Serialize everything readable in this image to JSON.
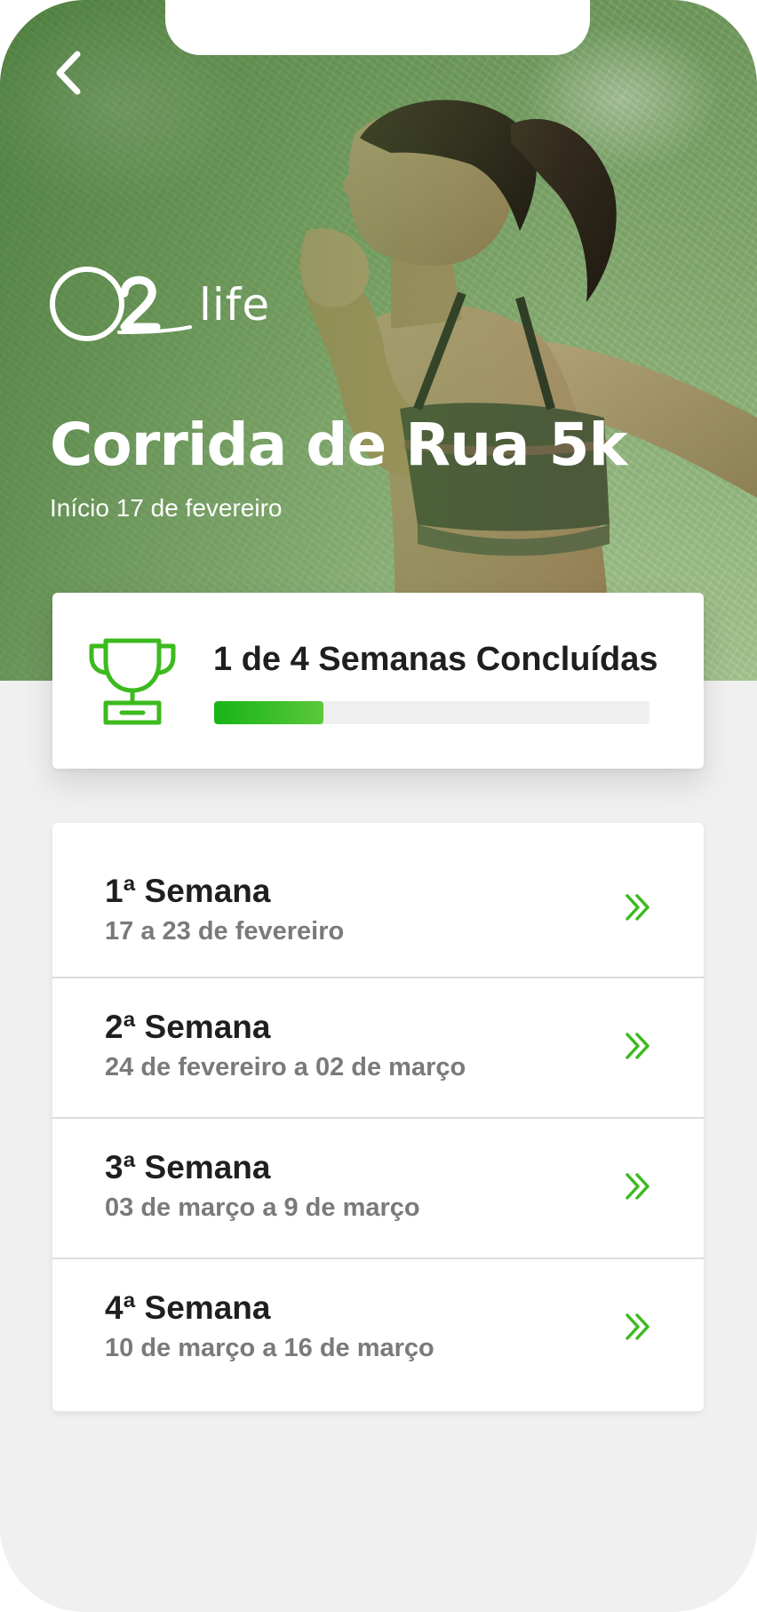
{
  "header": {
    "back_icon": "chevron-left-icon",
    "logo_text": "life",
    "title": "Corrida de Rua 5k",
    "subtitle": "Início 17 de fevereiro"
  },
  "progress": {
    "label": "1 de 4 Semanas Concluídas",
    "completed_weeks": 1,
    "total_weeks": 4,
    "fraction": 0.25,
    "icon": "trophy-icon"
  },
  "weeks": [
    {
      "title": "1ª Semana",
      "dates": "17 a 23 de fevereiro",
      "icon": "double-chevron-right-icon"
    },
    {
      "title": "2ª Semana",
      "dates": "24 de fevereiro a 02 de março",
      "icon": "double-chevron-right-icon"
    },
    {
      "title": "3ª Semana",
      "dates": "03 de março a 9 de março",
      "icon": "double-chevron-right-icon"
    },
    {
      "title": "4ª Semana",
      "dates": "10 de março a 16 de março",
      "icon": "double-chevron-right-icon"
    }
  ],
  "colors": {
    "accent": "#3cba1e",
    "hero_green": "#7fa86b",
    "background": "#f0f0f0",
    "title_text": "#1f1f1f",
    "secondary_text": "#7a7a7a"
  }
}
